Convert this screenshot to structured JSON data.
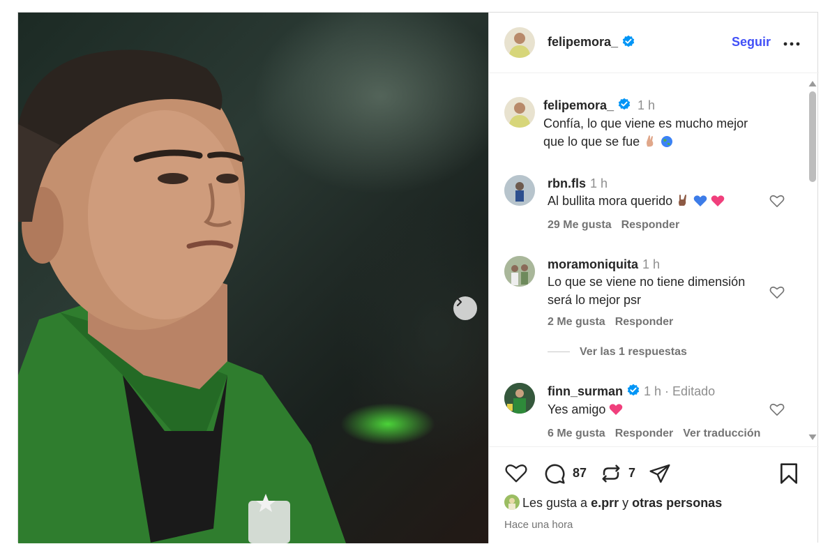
{
  "post": {
    "author": "felipemora_",
    "follow_label": "Seguir"
  },
  "caption": {
    "user": "felipemora_",
    "time": "1 h",
    "text_line1": "Confía, lo que viene es mucho mejor",
    "text_line2": "que lo que se fue"
  },
  "comments": [
    {
      "user": "rbn.fls",
      "time": "1 h",
      "text": "Al bullita mora querido",
      "likes": "29 Me gusta",
      "reply": "Responder"
    },
    {
      "user": "moramoniquita",
      "time": "1 h",
      "text_line1": "Lo que se viene no tiene dimensión",
      "text_line2": "será lo mejor psr",
      "likes": "2 Me gusta",
      "reply": "Responder",
      "view_replies": "Ver las 1 respuestas"
    },
    {
      "user": "finn_surman",
      "time": "1 h · Editado",
      "text": "Yes amigo",
      "likes": "6 Me gusta",
      "reply": "Responder",
      "translate": "Ver traducción"
    }
  ],
  "actions": {
    "comment_count": "87",
    "repost_count": "7"
  },
  "likes_line": {
    "prefix": "Les gusta a",
    "user": "e.prr",
    "connector": "y",
    "others": "otras personas"
  },
  "timestamp": "Hace una hora",
  "colors": {
    "link_blue": "#4150f7",
    "verified_blue": "#0095f6",
    "like_red": "#ff3040"
  },
  "icons": [
    "verified-icon",
    "more-icon",
    "heart-icon",
    "comment-icon",
    "repost-icon",
    "share-icon",
    "bookmark-icon",
    "chevron-right-icon"
  ]
}
